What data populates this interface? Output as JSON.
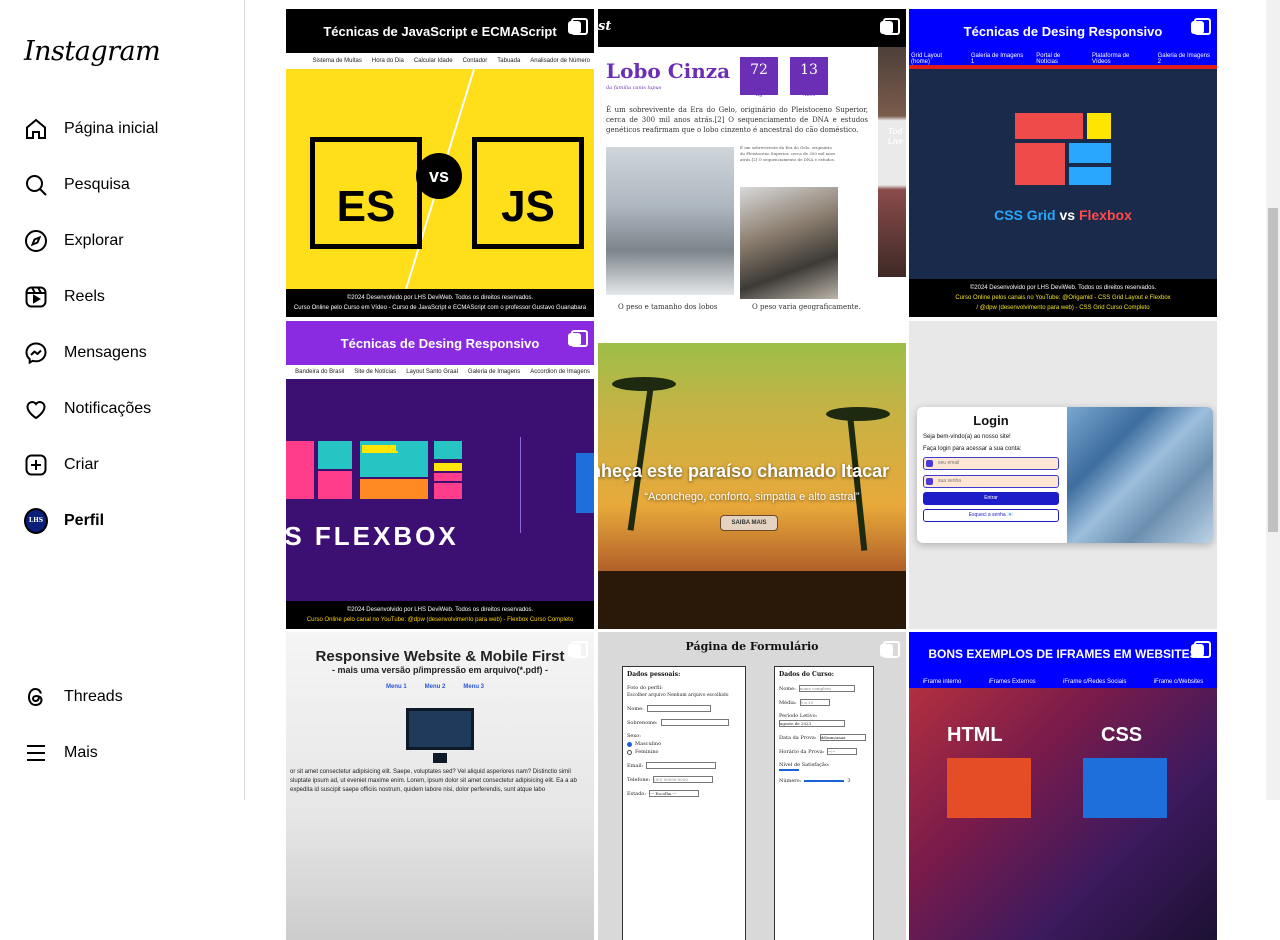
{
  "app": {
    "logo": "Instagram"
  },
  "sidebar": {
    "items": [
      {
        "label": "Página inicial",
        "icon": "home-icon"
      },
      {
        "label": "Pesquisa",
        "icon": "search-icon"
      },
      {
        "label": "Explorar",
        "icon": "compass-icon"
      },
      {
        "label": "Reels",
        "icon": "reels-icon"
      },
      {
        "label": "Mensagens",
        "icon": "messenger-icon"
      },
      {
        "label": "Notificações",
        "icon": "heart-icon"
      },
      {
        "label": "Criar",
        "icon": "plus-square-icon"
      },
      {
        "label": "Perfil",
        "icon": "avatar"
      }
    ],
    "avatar_text": "LHS",
    "bottom": [
      {
        "label": "Threads",
        "icon": "threads-icon"
      },
      {
        "label": "Mais",
        "icon": "menu-icon"
      }
    ]
  },
  "posts": {
    "p1": {
      "title": "Técnicas de JavaScript e ECMAScript",
      "menu": [
        "Sistema de Multas",
        "Hora do Dia",
        "Calcular Idade",
        "Contador",
        "Tabuada",
        "Analisador de Número"
      ],
      "left": "ES",
      "vs": "vs",
      "right": "JS",
      "footer1": "©2024 Desenvolvido por LHS DeviWeb. Todos os direitos reservados.",
      "footer2": "Curso Online pelo Curso em Vídeo - Curso de JavaScript e ECMAScript com o professor Gustavo Guanabara"
    },
    "p2": {
      "corner": "st",
      "title": "Lobo Cinza",
      "subtitle": "da família canis lupus",
      "stat1": "72",
      "stat1_label": "Kg",
      "stat2": "13",
      "stat2_label": "Anos",
      "paragraph": "É um sobrevivente da Era do Gelo, originário do Pleistoceno Superior, cerca de 300 mil anos atrás.[2] O sequenciamento de DNA e estudos genéticos reafirmam que o lobo cinzento é ancestral do cão doméstico.",
      "small_paragraph": "É um sobrevivente da Era do Gelo, originário do Pleistoceno Superior, cerca de 300 mil anos atrás.[2] O sequenciamento de DNA e estudos.",
      "side_text": "Tod Livr",
      "bottom_left": "O peso e tamanho dos lobos",
      "bottom_right": "O peso varia geograficamente."
    },
    "p3": {
      "title": "Técnicas de Desing Responsivo",
      "menu": [
        "Grid Layout (home)",
        "Galeria de Imagens 1",
        "Portal de Notícias",
        "Plataforma de Vídeos",
        "Galeria de Imagens 2"
      ],
      "h_left": "CSS Grid",
      "h_vs": "vs",
      "h_right": "Flexbox",
      "footer1": "©2024 Desenvolvido por LHS DeviWeb. Todos os direitos reservados.",
      "footer2": "Curso Online pelos canais no YouTube: @Origamid - CSS Grid Layout e Flexbox",
      "footer3": "/ @dpw (desenvolvimento para web) - CSS Grid Curso Completo"
    },
    "p4": {
      "title": "Técnicas de Desing Responsivo",
      "menu": [
        "Bandeira do Brasil",
        "Site de Notícias",
        "Layout Santo Graal",
        "Galeria de Imagens",
        "Accordion de Imagens"
      ],
      "headline": "SS FLEXBOX",
      "footer1": "©2024 Desenvolvido por LHS DeviWeb. Todos os direitos reservados.",
      "footer2": "Curso Online pelo canal no YouTube: @dpw (desenvolvimento para web) - Flexbox Curso Completo"
    },
    "p5": {
      "title": "nheça este paraíso chamado Itacar",
      "subtitle": "“Aconchego, conforto, simpatia e alto astral”",
      "button": "SAIBA MAIS"
    },
    "p6": {
      "title": "Login",
      "welcome": "Seja bem-vindo(a) ao nosso site!",
      "instruction": "Faça login para acessar a sua conta:",
      "email_placeholder": "seu email",
      "password_placeholder": "sua senha",
      "submit": "Entrar",
      "forgot": "Esqueci a senha 📧"
    },
    "p7": {
      "title": "Responsive Website & Mobile First",
      "subtitle": "- mais uma versão p/impressão em arquivo(*.pdf) -",
      "menu": [
        "Menu 1",
        "Menu 2",
        "Menu 3"
      ],
      "body": "or sit amet consectetur adipisicing elit. Saepe, voluptates sed? Vel aliquid asperiores nam? Distinctio simil sluptate ipsum ad, ut eveniet maxime enim. Lorem, ipsum dolor sit amet consectetur adipisicing elit. Ea a ab expedita id suscipit saepe officiis nostrum, quidem labore nisi, dolor perferendis, sunt atque labo"
    },
    "p8": {
      "title": "Página de Formulário",
      "left_legend": "Dados pessoais:",
      "left_rows": [
        "Foto do perfil:",
        "Escolher arquivo  Nenhum arquivo escolhido",
        "Nome:",
        "Sobrenome:",
        "Sexo:",
        "Masculino",
        "Feminino",
        "Email:",
        "Telefone:",
        "Estado:"
      ],
      "phone_placeholder": "(00) 00000-0000",
      "state_value": "--- Escolha ---",
      "right_legend": "Dados do Curso:",
      "right_rows": [
        "Nome:",
        "Média:",
        "Período Letivo:",
        "Data da Prova:",
        "Horário da Prova:",
        "Nível de Satisfação:",
        "Número:"
      ],
      "name_placeholder": "nome completo",
      "media_placeholder": "0 a 10",
      "period_value": "agosto de 2023",
      "date_value": "dd/mm/aaaa",
      "time_value": "--:--",
      "number_value": "3"
    },
    "p9": {
      "title": "BONS EXEMPLOS DE IFRAMES EM WEBSITES",
      "menu": [
        "iFrame interno",
        "iFrames Externos",
        "iFrame c/Redes Sociais",
        "iFrame c/Websites"
      ],
      "left": "HTML",
      "right": "CSS"
    }
  }
}
